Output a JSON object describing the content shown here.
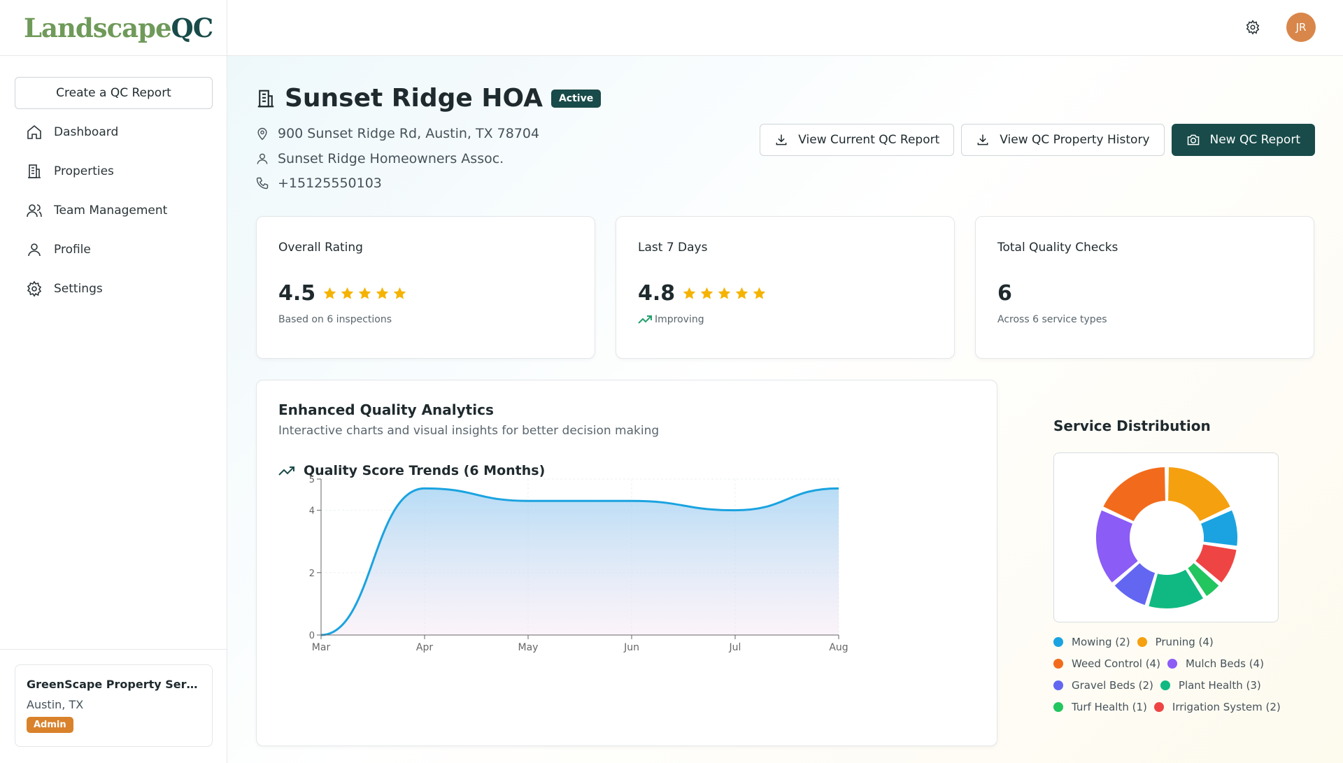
{
  "app": {
    "logo_main": "Landscape",
    "logo_accent": "QC"
  },
  "sidebar": {
    "create_label": "Create a QC Report",
    "items": [
      {
        "label": "Dashboard",
        "icon": "home-icon"
      },
      {
        "label": "Properties",
        "icon": "building-icon"
      },
      {
        "label": "Team Management",
        "icon": "users-icon"
      },
      {
        "label": "Profile",
        "icon": "user-icon"
      },
      {
        "label": "Settings",
        "icon": "gear-icon"
      }
    ],
    "org": {
      "name": "GreenScape Property Servi...",
      "location": "Austin, TX",
      "role": "Admin"
    }
  },
  "topbar": {
    "avatar_initials": "JR"
  },
  "property": {
    "name": "Sunset Ridge HOA",
    "status": "Active",
    "address": "900 Sunset Ridge Rd, Austin, TX 78704",
    "owner": "Sunset Ridge Homeowners Assoc.",
    "phone": "+15125550103"
  },
  "actions": {
    "view_current": "View Current QC Report",
    "view_history": "View QC Property History",
    "new_report": "New QC Report"
  },
  "stats": [
    {
      "label": "Overall Rating",
      "value": "4.5",
      "stars": 5,
      "sub": "Based on 6 inspections"
    },
    {
      "label": "Last 7 Days",
      "value": "4.8",
      "stars": 5,
      "sub": "Improving"
    },
    {
      "label": "Total Quality Checks",
      "value": "6",
      "sub": "Across 6 service types"
    }
  ],
  "analytics": {
    "title": "Enhanced Quality Analytics",
    "subtitle": "Interactive charts and visual insights for better decision making",
    "trend_title": "Quality Score Trends (6 Months)"
  },
  "service_distribution": {
    "title": "Service Distribution"
  },
  "colors": {
    "brand": "#184b49",
    "star": "#f5b301",
    "badge_admin": "#d9822b"
  },
  "chart_data": [
    {
      "type": "area",
      "title": "Quality Score Trends (6 Months)",
      "categories": [
        "Mar",
        "Apr",
        "May",
        "Jun",
        "Jul",
        "Aug"
      ],
      "values": [
        0,
        4.7,
        4.3,
        4.3,
        4.0,
        4.7
      ],
      "yticks": [
        0,
        2,
        4,
        5
      ],
      "ylim": [
        0,
        5
      ],
      "grid": true,
      "color": "#1aa3e0"
    },
    {
      "type": "pie",
      "title": "Service Distribution",
      "slices": [
        {
          "label": "Mowing",
          "count": 2,
          "color": "#1aa3e0"
        },
        {
          "label": "Pruning",
          "count": 4,
          "color": "#f5a00f"
        },
        {
          "label": "Weed Control",
          "count": 4,
          "color": "#f26b1d"
        },
        {
          "label": "Mulch Beds",
          "count": 4,
          "color": "#8b5cf6"
        },
        {
          "label": "Gravel Beds",
          "count": 2,
          "color": "#6366f1"
        },
        {
          "label": "Plant Health",
          "count": 3,
          "color": "#10b981"
        },
        {
          "label": "Turf Health",
          "count": 1,
          "color": "#22c55e"
        },
        {
          "label": "Irrigation System",
          "count": 2,
          "color": "#ef4444"
        }
      ],
      "legend_text": [
        "Mowing (2)",
        "Pruning (4)",
        "Weed Control (4)",
        "Mulch Beds (4)",
        "Gravel Beds (2)",
        "Plant Health (3)",
        "Turf Health (1)",
        "Irrigation System (2)"
      ]
    }
  ]
}
